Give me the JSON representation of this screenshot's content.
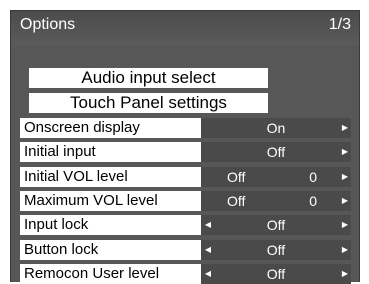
{
  "window": {
    "title": "Options",
    "page": "1/3"
  },
  "buttons": [
    {
      "label": "Audio input select"
    },
    {
      "label": "Touch Panel settings"
    }
  ],
  "settings": [
    {
      "label": "Onscreen display",
      "value": "On",
      "left_arrow": false,
      "right_arrow": true
    },
    {
      "label": "Initial input",
      "value": "Off",
      "left_arrow": false,
      "right_arrow": true
    },
    {
      "label": "Initial VOL level",
      "value": "Off",
      "number": "0",
      "left_arrow": false,
      "right_arrow": true
    },
    {
      "label": "Maximum VOL level",
      "value": "Off",
      "number": "0",
      "left_arrow": false,
      "right_arrow": true
    },
    {
      "label": "Input lock",
      "value": "Off",
      "left_arrow": true,
      "right_arrow": true
    },
    {
      "label": "Button lock",
      "value": "Off",
      "left_arrow": true,
      "right_arrow": true
    },
    {
      "label": "Remocon User level",
      "value": "Off",
      "left_arrow": true,
      "right_arrow": true
    }
  ],
  "icons": {
    "left_arrow": "left-triangle-icon",
    "right_arrow": "right-triangle-icon"
  },
  "colors": {
    "frame": "#575757",
    "value_box": "#4a4a4a",
    "row": "#ffffff"
  }
}
